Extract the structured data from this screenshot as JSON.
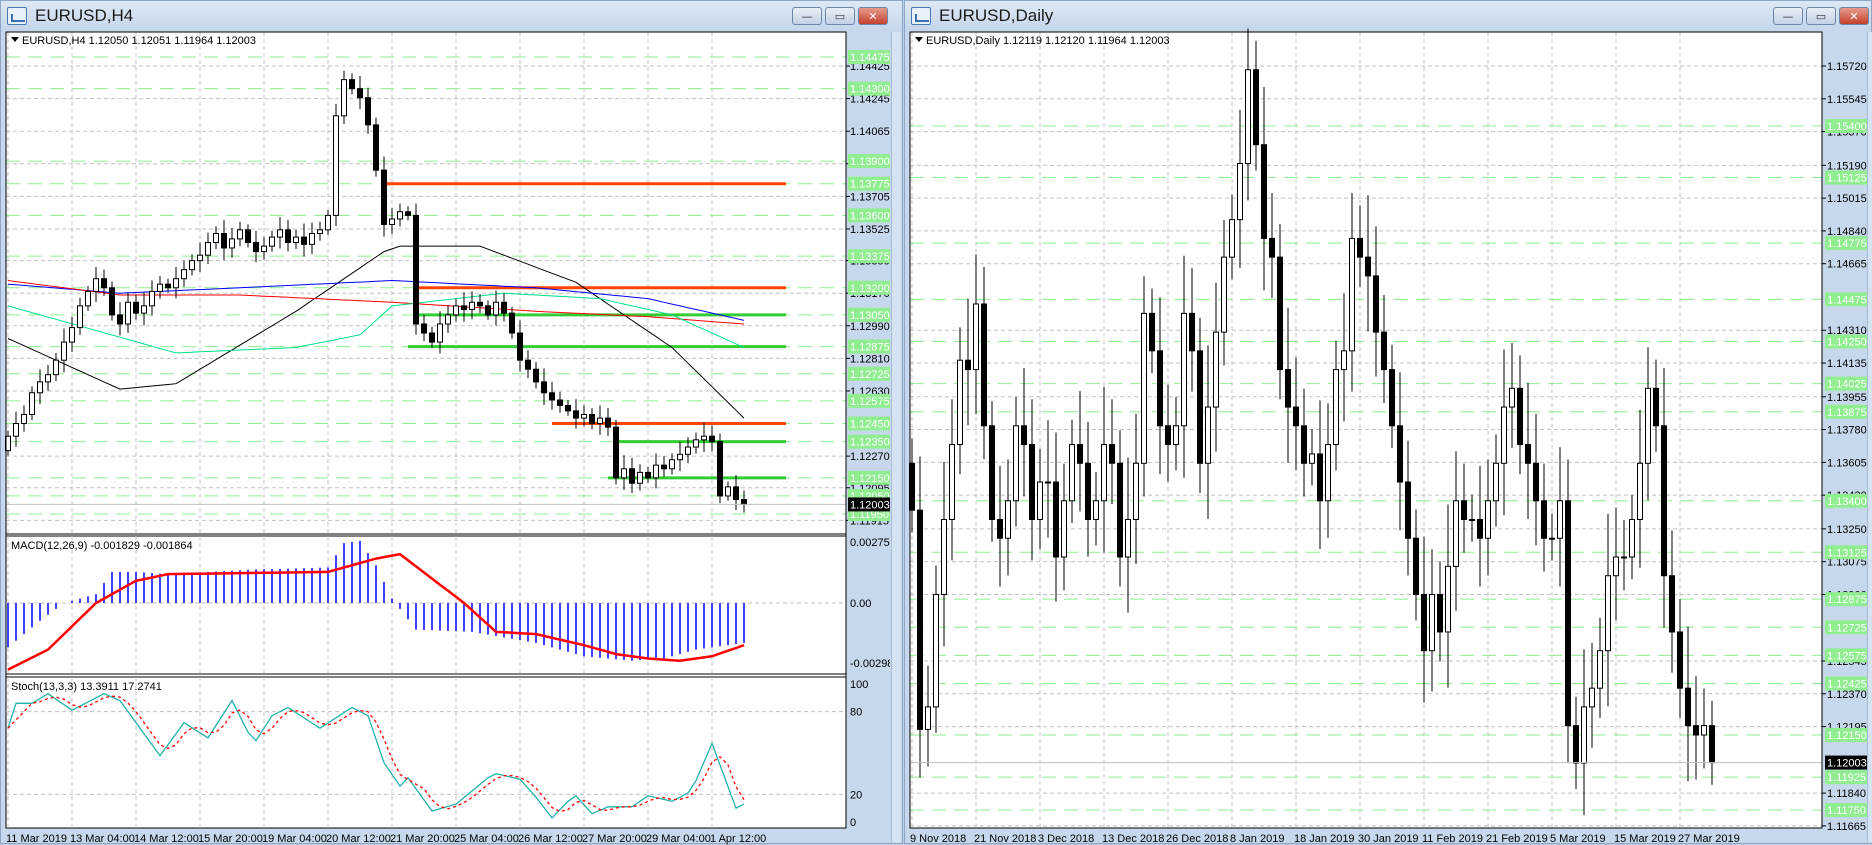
{
  "colors": {
    "bull": "#ffffff",
    "bear": "#000000",
    "level_green": "#32cd32",
    "level_red": "#ff4500",
    "label_green": "#90ee90",
    "grid": "#c0c0c0",
    "macd_hist": "#0000ff",
    "macd_signal": "#ff0000",
    "stoch_k": "#20b2aa",
    "stoch_d": "#ff0000"
  },
  "left": {
    "title": "EURUSD,H4",
    "header": "EURUSD,H4  1.12050 1.12051 1.11964 1.12003",
    "buttons": {
      "minimize": "—",
      "restore": "▭",
      "close": "✕"
    },
    "price_ticks": [
      "1.14425",
      "1.14245",
      "1.14065",
      "1.13885",
      "1.13705",
      "1.13525",
      "1.13350",
      "1.13170",
      "1.12990",
      "1.12810",
      "1.12630",
      "1.12270",
      "1.12095",
      "1.11915"
    ],
    "level_labels": [
      "1.14475",
      "1.14300",
      "1.13900",
      "1.13775",
      "1.13600",
      "1.13375",
      "1.13200",
      "1.13050",
      "1.12875",
      "1.12725",
      "1.12575",
      "1.12450",
      "1.12350",
      "1.12150",
      "1.12050",
      "1.11950"
    ],
    "current_price": "1.12003",
    "levels": [
      {
        "price": 1.13775,
        "color": "red",
        "from_bar": 47
      },
      {
        "price": 1.132,
        "color": "red",
        "from_bar": 51
      },
      {
        "price": 1.1305,
        "color": "green",
        "from_bar": 51
      },
      {
        "price": 1.12875,
        "color": "green",
        "from_bar": 50
      },
      {
        "price": 1.1245,
        "color": "red",
        "from_bar": 68
      },
      {
        "price": 1.1235,
        "color": "green",
        "from_bar": 76
      },
      {
        "price": 1.1215,
        "color": "green",
        "from_bar": 75
      }
    ],
    "time_labels": [
      "11 Mar 2019",
      "13 Mar 04:00",
      "14 Mar 12:00",
      "15 Mar 20:00",
      "19 Mar 04:00",
      "20 Mar 12:00",
      "21 Mar 20:00",
      "25 Mar 04:00",
      "26 Mar 12:00",
      "27 Mar 20:00",
      "29 Mar 04:00",
      "1 Apr 12:00"
    ],
    "closes": [
      1.1238,
      1.1245,
      1.125,
      1.1262,
      1.1268,
      1.1272,
      1.128,
      1.129,
      1.1298,
      1.131,
      1.1318,
      1.1325,
      1.132,
      1.1305,
      1.13,
      1.1312,
      1.1306,
      1.131,
      1.1318,
      1.1322,
      1.132,
      1.1325,
      1.133,
      1.1335,
      1.1338,
      1.1345,
      1.135,
      1.1342,
      1.1347,
      1.1352,
      1.1345,
      1.134,
      1.1343,
      1.1348,
      1.1352,
      1.1345,
      1.1348,
      1.1344,
      1.135,
      1.1352,
      1.136,
      1.1415,
      1.1435,
      1.143,
      1.1425,
      1.141,
      1.1385,
      1.1355,
      1.1358,
      1.1362,
      1.136,
      1.13,
      1.1295,
      1.129,
      1.13,
      1.1305,
      1.131,
      1.1308,
      1.1312,
      1.131,
      1.1305,
      1.1312,
      1.1306,
      1.1295,
      1.128,
      1.1275,
      1.1268,
      1.1262,
      1.1258,
      1.1255,
      1.1252,
      1.1248,
      1.125,
      1.1245,
      1.1248,
      1.1243,
      1.1215,
      1.122,
      1.1212,
      1.1218,
      1.1215,
      1.1222,
      1.122,
      1.1225,
      1.1228,
      1.1232,
      1.1236,
      1.1238,
      1.1235,
      1.1205,
      1.121,
      1.1203,
      1.12003
    ],
    "moving_averages": [
      {
        "color": "#000000",
        "points": [
          [
            0,
            1.1292
          ],
          [
            14,
            1.1264
          ],
          [
            21,
            1.1267
          ],
          [
            36,
            1.1307
          ],
          [
            47,
            1.134
          ],
          [
            49,
            1.1343
          ],
          [
            59,
            1.1343
          ],
          [
            71,
            1.1323
          ],
          [
            83,
            1.1287
          ],
          [
            92,
            1.1248
          ]
        ]
      },
      {
        "color": "#0000ff",
        "points": [
          [
            0,
            1.1322
          ],
          [
            14,
            1.1317
          ],
          [
            29,
            1.132
          ],
          [
            48,
            1.1324
          ],
          [
            66,
            1.132
          ],
          [
            80,
            1.1314
          ],
          [
            92,
            1.1302
          ]
        ]
      },
      {
        "color": "#ff0000",
        "points": [
          [
            0,
            1.1324
          ],
          [
            14,
            1.1316
          ],
          [
            29,
            1.1316
          ],
          [
            48,
            1.1312
          ],
          [
            66,
            1.1307
          ],
          [
            80,
            1.1304
          ],
          [
            92,
            1.13
          ]
        ]
      },
      {
        "color": "#00e08a",
        "points": [
          [
            0,
            1.131
          ],
          [
            21,
            1.1284
          ],
          [
            36,
            1.1287
          ],
          [
            44,
            1.1294
          ],
          [
            48,
            1.131
          ],
          [
            62,
            1.1317
          ],
          [
            74,
            1.1314
          ],
          [
            83,
            1.1305
          ],
          [
            92,
            1.1287
          ]
        ]
      }
    ],
    "macd": {
      "label": "MACD(12,26,9) -0.001829 -0.001864",
      "ticks": [
        "0.00275",
        "0.00",
        "-0.002983"
      ],
      "hist_knots": [
        [
          0,
          -0.002
        ],
        [
          4,
          -0.0008
        ],
        [
          7,
          0.0
        ],
        [
          11,
          0.0004
        ],
        [
          13,
          0.0014
        ],
        [
          16,
          0.0014
        ],
        [
          20,
          0.0013
        ],
        [
          30,
          0.0015
        ],
        [
          40,
          0.0016
        ],
        [
          42,
          0.0027
        ],
        [
          44,
          0.0028
        ],
        [
          46,
          0.0017
        ],
        [
          48,
          0.0002
        ],
        [
          51,
          -0.0012
        ],
        [
          58,
          -0.0013
        ],
        [
          66,
          -0.0018
        ],
        [
          72,
          -0.0024
        ],
        [
          78,
          -0.0026
        ],
        [
          82,
          -0.0025
        ],
        [
          86,
          -0.0021
        ],
        [
          92,
          -0.0018
        ]
      ],
      "signal_knots": [
        [
          0,
          -0.003
        ],
        [
          5,
          -0.0021
        ],
        [
          11,
          0.0
        ],
        [
          16,
          0.001
        ],
        [
          20,
          0.0013
        ],
        [
          40,
          0.0014
        ],
        [
          46,
          0.002
        ],
        [
          49,
          0.0022
        ],
        [
          57,
          0.0
        ],
        [
          61,
          -0.0013
        ],
        [
          66,
          -0.0014
        ],
        [
          72,
          -0.0019
        ],
        [
          76,
          -0.0023
        ],
        [
          80,
          -0.0025
        ],
        [
          84,
          -0.0026
        ],
        [
          88,
          -0.0024
        ],
        [
          92,
          -0.0019
        ]
      ]
    },
    "stoch": {
      "label": "Stoch(13,3,3) 13.3911 17.2741",
      "ticks": [
        "100",
        "80",
        "20",
        "0"
      ],
      "k_knots": [
        [
          0,
          68
        ],
        [
          1,
          86
        ],
        [
          3,
          86
        ],
        [
          5,
          93
        ],
        [
          8,
          81
        ],
        [
          12,
          93
        ],
        [
          14,
          88
        ],
        [
          16,
          72
        ],
        [
          19,
          48
        ],
        [
          22,
          72
        ],
        [
          25,
          61
        ],
        [
          28,
          88
        ],
        [
          30,
          65
        ],
        [
          31,
          59
        ],
        [
          33,
          77
        ],
        [
          35,
          83
        ],
        [
          39,
          68
        ],
        [
          43,
          83
        ],
        [
          45,
          77
        ],
        [
          47,
          43
        ],
        [
          49,
          26
        ],
        [
          50,
          32
        ],
        [
          53,
          8
        ],
        [
          56,
          13
        ],
        [
          60,
          32
        ],
        [
          61,
          35
        ],
        [
          64,
          31
        ],
        [
          66,
          18
        ],
        [
          68,
          3
        ],
        [
          70,
          15
        ],
        [
          71,
          19
        ],
        [
          73,
          6
        ],
        [
          75,
          11
        ],
        [
          78,
          11
        ],
        [
          80,
          19
        ],
        [
          83,
          15
        ],
        [
          85,
          21
        ],
        [
          86,
          30
        ],
        [
          88,
          57
        ],
        [
          91,
          10
        ],
        [
          92,
          13
        ]
      ]
    }
  },
  "right": {
    "title": "EURUSD,Daily",
    "header": "EURUSD,Daily  1.12119 1.12120 1.11964 1.12003",
    "buttons": {
      "minimize": "—",
      "restore": "▭",
      "close": "✕"
    },
    "price_ticks": [
      "1.15720",
      "1.15545",
      "1.15370",
      "1.15190",
      "1.15015",
      "1.14840",
      "1.14665",
      "1.14310",
      "1.14135",
      "1.13955",
      "1.13780",
      "1.13605",
      "1.13430",
      "1.13250",
      "1.13075",
      "1.12900",
      "1.12545",
      "1.12370",
      "1.12195",
      "1.11840",
      "1.11665"
    ],
    "level_labels": [
      "1.15400",
      "1.15125",
      "1.14775",
      "1.14475",
      "1.14250",
      "1.14025",
      "1.13875",
      "1.13400",
      "1.13125",
      "1.12875",
      "1.12725",
      "1.12575",
      "1.12425",
      "1.12150",
      "1.11925",
      "1.11750"
    ],
    "current_price": "1.12003",
    "time_labels": [
      "9 Nov 2018",
      "21 Nov 2018",
      "3 Dec 2018",
      "13 Dec 2018",
      "26 Dec 2018",
      "8 Jan 2019",
      "18 Jan 2019",
      "30 Jan 2019",
      "11 Feb 2019",
      "21 Feb 2019",
      "5 Mar 2019",
      "15 Mar 2019",
      "27 Mar 2019"
    ],
    "closes": [
      1.1335,
      1.1218,
      1.123,
      1.129,
      1.133,
      1.137,
      1.1415,
      1.141,
      1.1445,
      1.138,
      1.133,
      1.132,
      1.134,
      1.138,
      1.137,
      1.133,
      1.135,
      1.135,
      1.131,
      1.134,
      1.137,
      1.136,
      1.133,
      1.134,
      1.137,
      1.136,
      1.131,
      1.133,
      1.136,
      1.144,
      1.142,
      1.138,
      1.137,
      1.138,
      1.144,
      1.142,
      1.136,
      1.139,
      1.143,
      1.147,
      1.149,
      1.152,
      1.157,
      1.153,
      1.148,
      1.147,
      1.141,
      1.139,
      1.138,
      1.136,
      1.1365,
      1.134,
      1.137,
      1.141,
      1.142,
      1.148,
      1.147,
      1.146,
      1.143,
      1.141,
      1.138,
      1.135,
      1.132,
      1.129,
      1.126,
      1.129,
      1.127,
      1.1305,
      1.134,
      1.133,
      1.133,
      1.132,
      1.134,
      1.136,
      1.139,
      1.14,
      1.137,
      1.136,
      1.134,
      1.132,
      1.132,
      1.134,
      1.122,
      1.12,
      1.123,
      1.124,
      1.126,
      1.13,
      1.131,
      1.131,
      1.133,
      1.136,
      1.14,
      1.138,
      1.13,
      1.127,
      1.124,
      1.122,
      1.1215,
      1.122,
      1.12003
    ]
  }
}
